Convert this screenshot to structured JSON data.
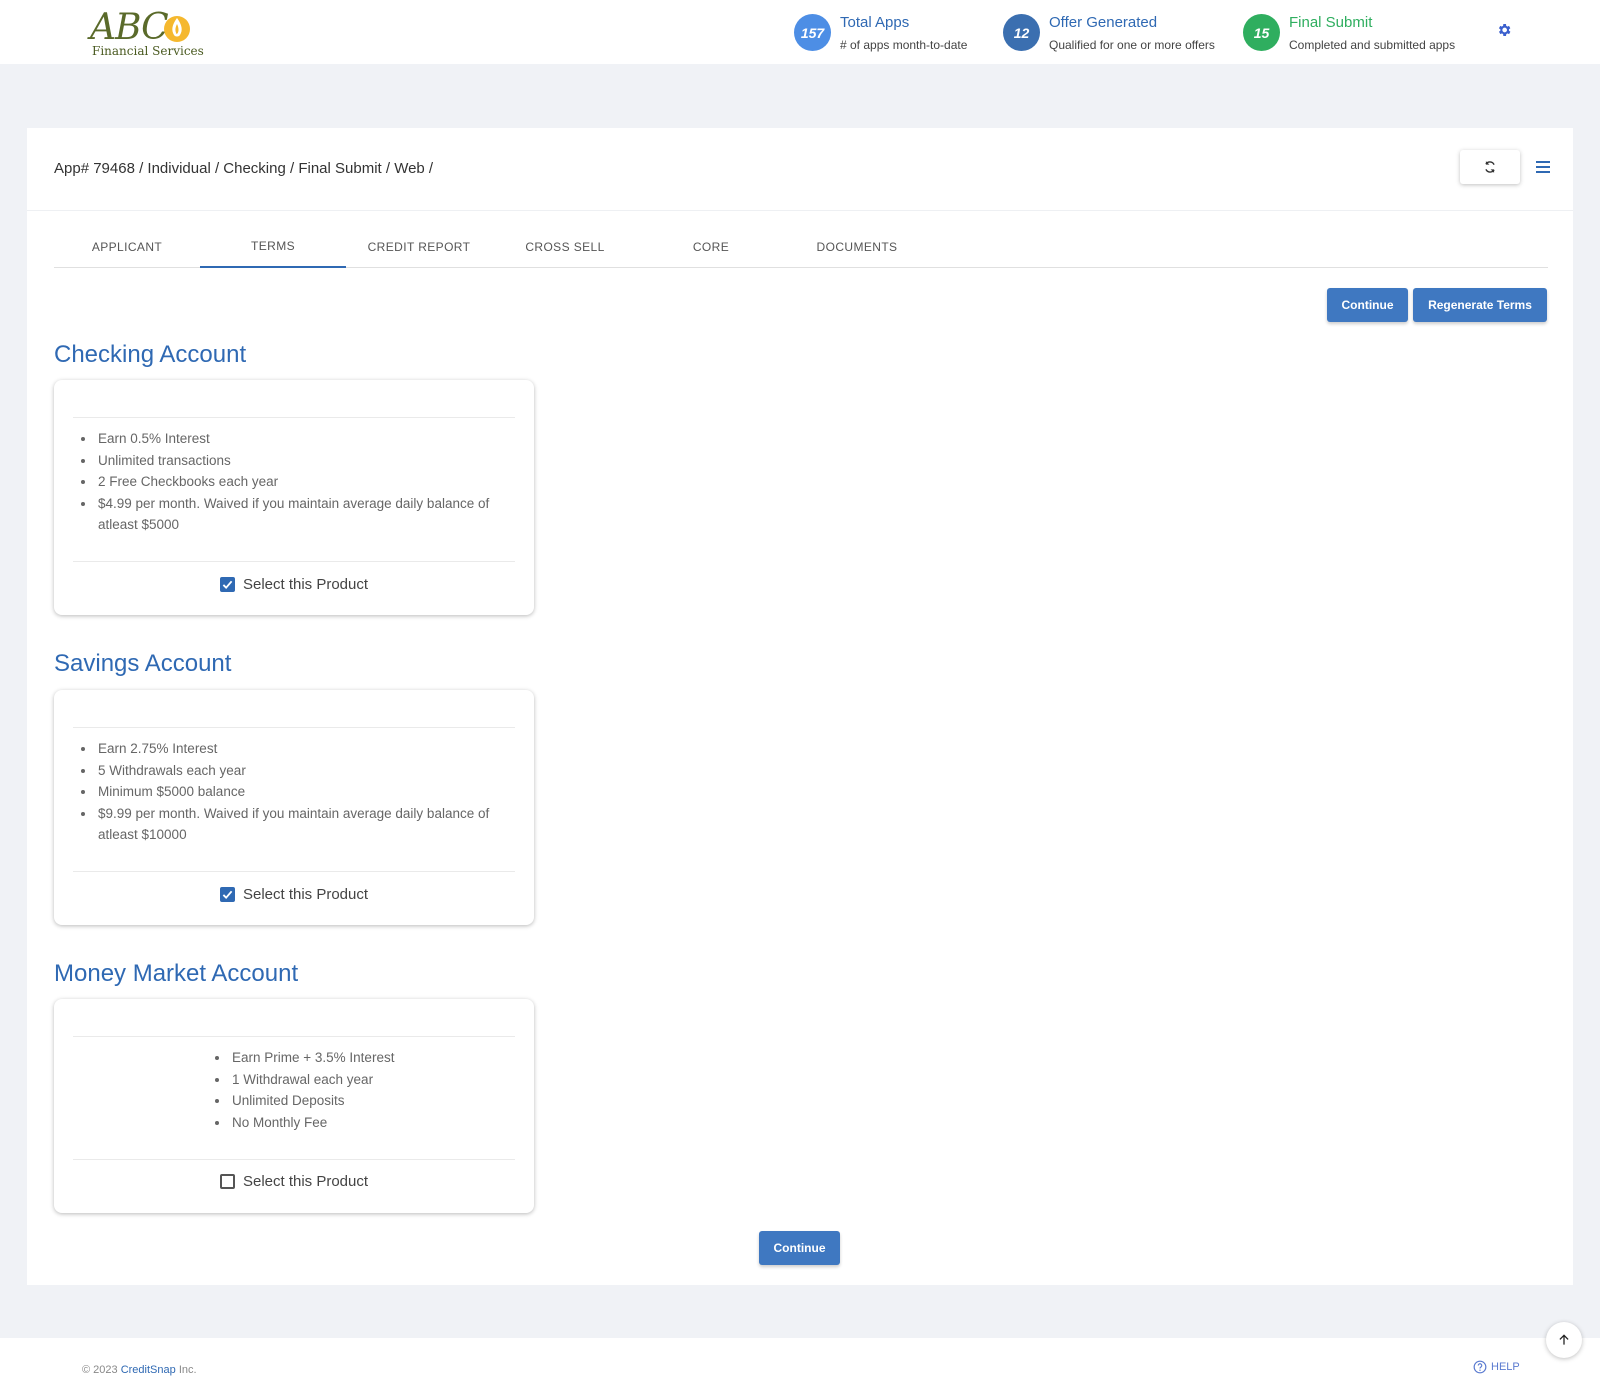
{
  "header": {
    "logo": {
      "text": "ABC",
      "subtitle": "Financial Services"
    },
    "stats": [
      {
        "value": "157",
        "title": "Total Apps",
        "subtitle": "# of apps month-to-date",
        "color": "#4d8ee5",
        "title_color": "#2f69b3"
      },
      {
        "value": "12",
        "title": "Offer Generated",
        "subtitle": "Qualified for one or more offers",
        "color": "#3b6fb0",
        "title_color": "#2f69b3"
      },
      {
        "value": "15",
        "title": "Final Submit",
        "subtitle": "Completed and submitted apps",
        "color": "#2fae5f",
        "title_color": "#2fae5f"
      }
    ],
    "settings_icon": "gear-icon"
  },
  "breadcrumb": "App# 79468 / Individual / Checking / Final Submit / Web /",
  "tabs": [
    {
      "label": "APPLICANT",
      "active": false
    },
    {
      "label": "TERMS",
      "active": true
    },
    {
      "label": "CREDIT REPORT",
      "active": false
    },
    {
      "label": "CROSS SELL",
      "active": false
    },
    {
      "label": "CORE",
      "active": false
    },
    {
      "label": "DOCUMENTS",
      "active": false
    }
  ],
  "actions": {
    "continue_label": "Continue",
    "regenerate_label": "Regenerate Terms"
  },
  "products": [
    {
      "title": "Checking Account",
      "features": [
        "Earn 0.5% Interest",
        "Unlimited transactions",
        "2 Free Checkbooks each year",
        "$4.99 per month. Waived if you maintain average daily balance of atleast $5000"
      ],
      "select_label": "Select this Product",
      "selected": true
    },
    {
      "title": "Savings Account",
      "features": [
        "Earn 2.75% Interest",
        "5 Withdrawals each year",
        "Minimum $5000 balance",
        "$9.99 per month. Waived if you maintain average daily balance of atleast $10000"
      ],
      "select_label": "Select this Product",
      "selected": true
    },
    {
      "title": "Money Market Account",
      "features": [
        "Earn Prime + 3.5% Interest",
        "1 Withdrawal each year",
        "Unlimited Deposits",
        "No Monthly Fee"
      ],
      "select_label": "Select this Product",
      "selected": false
    }
  ],
  "bottom_continue_label": "Continue",
  "footer": {
    "copyright_prefix": "© 2023",
    "company": "CreditSnap",
    "copyright_suffix": "Inc.",
    "help_label": "HELP"
  },
  "colors": {
    "accent": "#2f69b3",
    "button": "#3f78c1",
    "background": "#f0f2f6"
  }
}
